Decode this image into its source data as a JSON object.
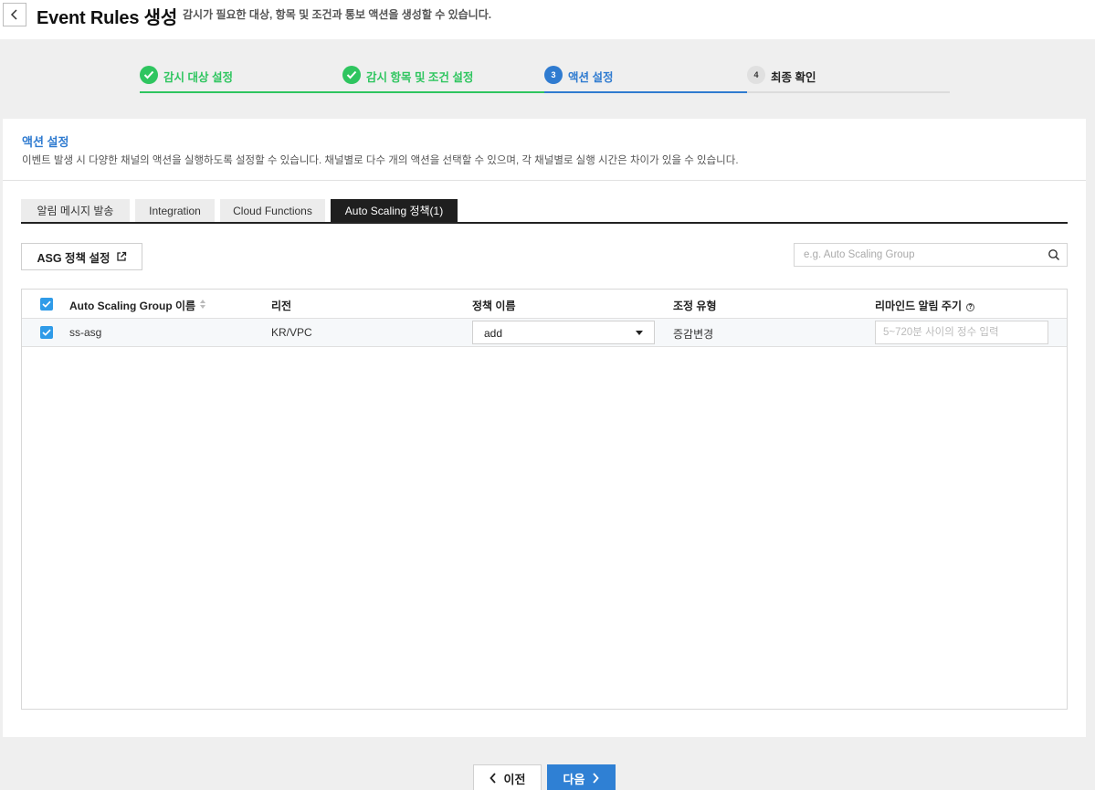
{
  "header": {
    "title": "Event Rules 생성",
    "subtitle": "감시가 필요한 대상, 항목 및 조건과 통보 액션을 생성할 수 있습니다."
  },
  "stepper": {
    "steps": [
      {
        "number": "1",
        "label": "감시 대상 설정",
        "state": "done"
      },
      {
        "number": "2",
        "label": "감시 항목 및 조건 설정",
        "state": "done"
      },
      {
        "number": "3",
        "label": "액션 설정",
        "state": "active"
      },
      {
        "number": "4",
        "label": "최종 확인",
        "state": "todo"
      }
    ]
  },
  "section": {
    "title": "액션 설정",
    "description": "이벤트 발생 시 다양한 채널의 액션을 실행하도록 설정할 수 있습니다. 채널별로 다수 개의 액션을 선택할 수 있으며, 각 채널별로 실행 시간은 차이가 있을 수 있습니다."
  },
  "tabs": [
    {
      "label": "알림 메시지 발송",
      "active": false
    },
    {
      "label": "Integration",
      "active": false
    },
    {
      "label": "Cloud Functions",
      "active": false
    },
    {
      "label": "Auto Scaling 정책(1)",
      "active": true
    }
  ],
  "toolbar": {
    "asg_button_label": "ASG 정책 설정",
    "search_placeholder": "e.g. Auto Scaling Group"
  },
  "table": {
    "columns": [
      "Auto Scaling Group 이름",
      "리전",
      "정책 이름",
      "조정 유형",
      "리마인드 알림 주기"
    ],
    "rows": [
      {
        "checked": true,
        "group_name": "ss-asg",
        "region": "KR/VPC",
        "policy": "add",
        "adjust_type": "증감변경",
        "remind_placeholder": "5~720분 사이의 정수 입력"
      }
    ]
  },
  "footer": {
    "prev_label": "이전",
    "next_label": "다음"
  },
  "colors": {
    "done": "#2ec55f",
    "active": "#2f7bd0",
    "primary_button": "#2f80d4",
    "checkbox": "#2f9be8"
  }
}
